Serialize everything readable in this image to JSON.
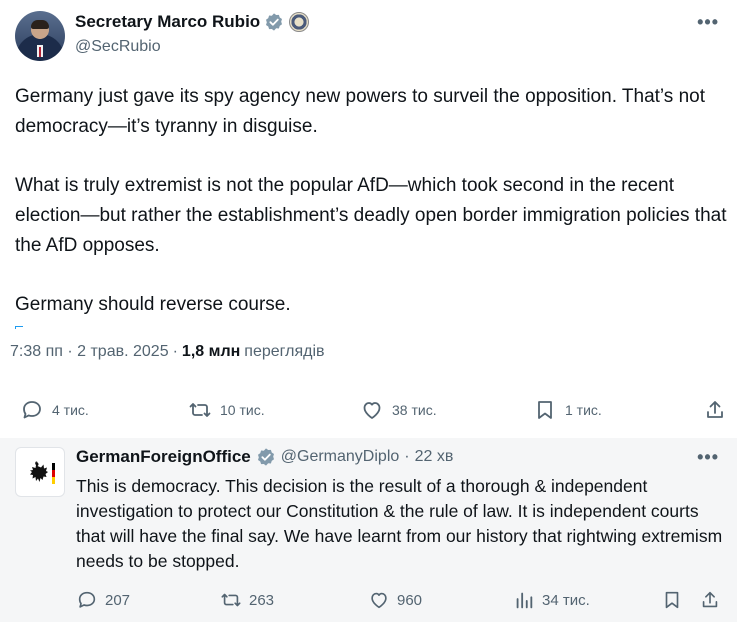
{
  "tweet": {
    "display_name": "Secretary Marco Rubio",
    "handle": "@SecRubio",
    "more_label": "•••",
    "paragraphs": [
      "Germany just gave its spy agency new powers to surveil the opposition. That’s not democracy—it’s tyranny in disguise.",
      "What is truly extremist is not the popular AfD—which took second in the recent election—but rather the establishment’s deadly open border immigration policies that the AfD opposes.",
      "Germany should reverse course."
    ],
    "timestamp": "7:38 пп · 2 трав. 2025",
    "separator": "·",
    "views_count": "1,8 млн",
    "views_label": "переглядів",
    "actions": {
      "replies": "4 тис.",
      "reposts": "10 тис.",
      "likes": "38 тис.",
      "bookmarks": "1 тис."
    },
    "colors": {
      "verified": "#829aab",
      "text": "#0f1419",
      "muted": "#536471"
    }
  },
  "reply": {
    "display_name": "GermanForeignOffice",
    "handle": "@GermanyDiplo",
    "dot": "·",
    "time": "22 хв",
    "more_label": "•••",
    "text": "This is democracy. This decision is the result of a thorough & independent investigation to protect our Constitution & the rule of law. It is independent courts that will have the final say. We have learnt from our history that rightwing extremism needs to be stopped.",
    "actions": {
      "replies": "207",
      "reposts": "263",
      "likes": "960",
      "views": "34 тис."
    }
  },
  "icons": [
    "verified-badge-icon",
    "government-seal-icon",
    "more-icon",
    "reply-icon",
    "repost-icon",
    "like-icon",
    "bookmark-icon",
    "share-icon",
    "views-icon",
    "eagle-icon"
  ]
}
